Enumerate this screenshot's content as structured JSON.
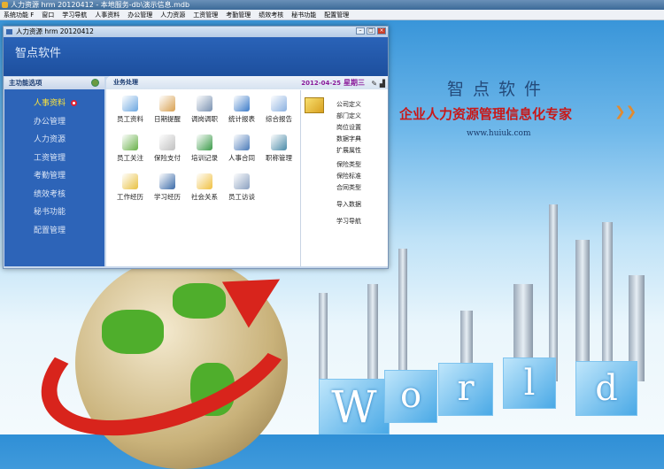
{
  "titlebar": {
    "title": "人力资源 hrm 20120412 - 本地服务-db\\演示信息.mdb"
  },
  "menu": [
    "系统功能 F",
    "窗口",
    "学习导航",
    "人事资料",
    "办公管理",
    "人力资源",
    "工资管理",
    "考勤管理",
    "绩效考核",
    "秘书功能",
    "配置管理"
  ],
  "background": {
    "company": "智点软件",
    "slogan": "企业人力资源管理信息化专家",
    "arrows": "❯❯",
    "url": "www.huiuk.com",
    "world_letters": [
      "W",
      "o",
      "r",
      "l",
      "d"
    ]
  },
  "window": {
    "title": "人力资源 hrm 20120412",
    "header": "智点软件",
    "buttons": [
      "–",
      "□",
      "×"
    ]
  },
  "sidebar": {
    "title": "主功能选项",
    "items": [
      "人事资料",
      "办公管理",
      "人力资源",
      "工资管理",
      "考勤管理",
      "绩效考核",
      "秘书功能",
      "配置管理"
    ]
  },
  "main": {
    "title": "业务处理",
    "date": "2012-04-25",
    "weekday": "星期三",
    "tools": "✎ ▟",
    "tiles": [
      "员工资料",
      "日期提醒",
      "调岗调职",
      "统计报表",
      "综合报告",
      "员工关注",
      "保险支付",
      "培训记录",
      "人事合同",
      "职称管理",
      "工作经历",
      "学习经历",
      "社会关系",
      "员工访谈"
    ],
    "tile_colors": [
      "#6aa6e0",
      "#d8a050",
      "#7890b0",
      "#3a7ac8",
      "#8ab0e0",
      "#68b048",
      "#c0c0c0",
      "#3a9a48",
      "#4a7ab8",
      "#4a8aa8",
      "#e8c040",
      "#3a6aa8",
      "#f0c040",
      "#8aa0c0"
    ],
    "links": [
      "公司定义",
      "部门定义",
      "岗位设置",
      "数据字典",
      "扩展属性",
      "保险类型",
      "保险标准",
      "合同类型",
      "导入数据",
      "学习导航"
    ]
  }
}
